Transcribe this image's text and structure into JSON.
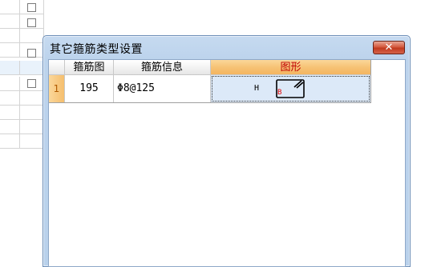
{
  "dialog": {
    "title": "其它箍筋类型设置",
    "close_label": "✕"
  },
  "grid": {
    "columns": [
      "箍筋图",
      "箍筋信息",
      "图形"
    ],
    "rows": [
      {
        "index": "1",
        "stirrup_figure": "195",
        "stirrup_info": "Φ8@125",
        "shape_label_h": "H",
        "shape_label_b": "B"
      }
    ]
  },
  "background": {
    "checkboxes": 4
  },
  "colors": {
    "selected_header": "#f6c173",
    "selected_cell": "#dce9f8",
    "header_text_selected": "#c00000",
    "close_button": "#c13a1f"
  }
}
